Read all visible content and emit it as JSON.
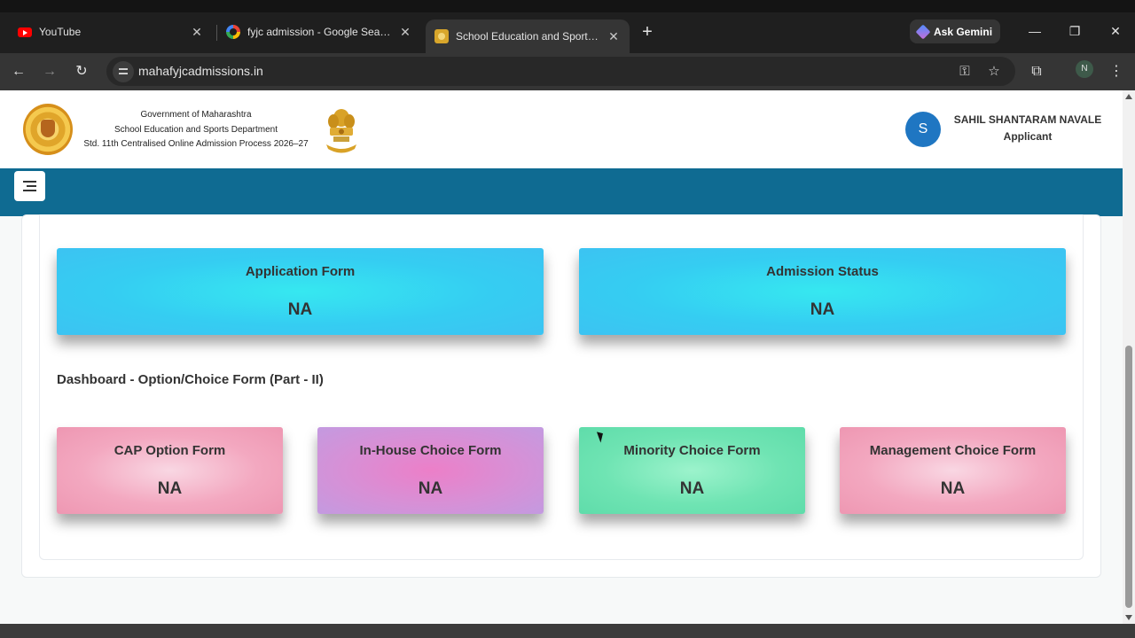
{
  "browser": {
    "tabs": [
      {
        "title": "YouTube",
        "icon": "youtube-icon"
      },
      {
        "title": "fyjc admission - Google Search",
        "icon": "google-icon"
      },
      {
        "title": "School Education and Sport Depar",
        "icon": "emblem-favicon",
        "active": true
      }
    ],
    "new_tab_symbol": "+",
    "gemini_label": "Ask Gemini",
    "url": "mahafyjcadmissions.in",
    "profile_initial": "N"
  },
  "header": {
    "gov_line1": "Government of Maharashtra",
    "gov_line2": "School Education and Sports Department",
    "gov_line3": "Std. 11th Centralised Online Admission Process 2026–27",
    "user_initial": "S",
    "user_name": "SAHIL SHANTARAM NAVALE",
    "user_role": "Applicant"
  },
  "navband_color": "#0f6b92",
  "top_cards": [
    {
      "title": "Application Form",
      "value": "NA",
      "color": "blue"
    },
    {
      "title": "Admission Status",
      "value": "NA",
      "color": "blue"
    }
  ],
  "section_title": "Dashboard - Option/Choice Form (Part - II)",
  "choice_cards": [
    {
      "title": "CAP Option Form",
      "value": "NA",
      "color": "pink"
    },
    {
      "title": "In-House Choice Form",
      "value": "NA",
      "color": "purple"
    },
    {
      "title": "Minority Choice Form",
      "value": "NA",
      "color": "green"
    },
    {
      "title": "Management Choice Form",
      "value": "NA",
      "color": "pink"
    }
  ]
}
